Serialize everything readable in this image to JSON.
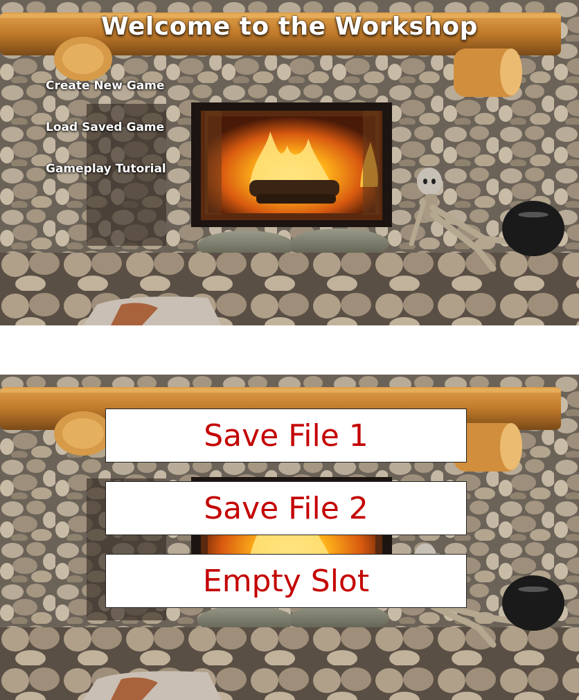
{
  "main_menu": {
    "title": "Welcome to the Workshop",
    "items": [
      {
        "label": "Create New Game"
      },
      {
        "label": "Load Saved Game"
      },
      {
        "label": "Gameplay Tutorial"
      }
    ]
  },
  "load_menu": {
    "slots": [
      {
        "label": "Save File 1"
      },
      {
        "label": "Save File 2"
      },
      {
        "label": "Empty Slot"
      }
    ]
  },
  "colors": {
    "title_text": "#ffffff",
    "slot_text": "#c40000",
    "slot_background": "#ffffff"
  }
}
